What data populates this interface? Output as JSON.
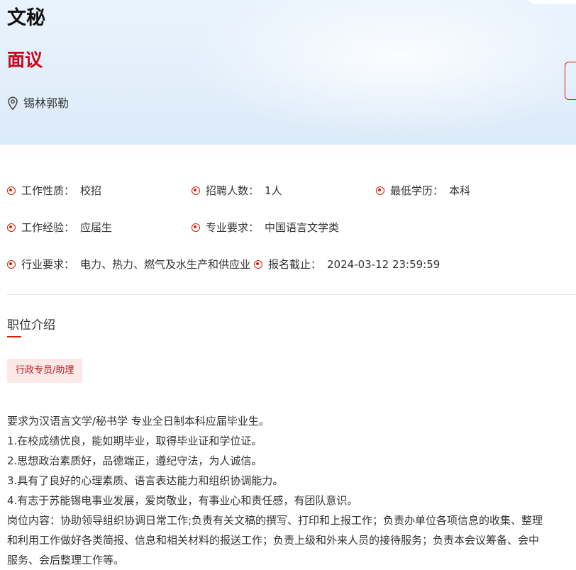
{
  "header": {
    "title": "文秘",
    "salary": "面议",
    "location": "锡林郭勒"
  },
  "info": {
    "row1": [
      {
        "label": "工作性质：",
        "value": "校招"
      },
      {
        "label": "招聘人数：",
        "value": "1人"
      },
      {
        "label": "最低学历：",
        "value": "本科"
      }
    ],
    "row2": [
      {
        "label": "工作经验：",
        "value": "应届生"
      },
      {
        "label": "专业要求：",
        "value": "中国语言文学类"
      }
    ],
    "row3": [
      {
        "label": "行业要求：",
        "value": "电力、热力、燃气及水生产和供应业"
      },
      {
        "label": "报名截止：",
        "value": "2024-03-12 23:59:59"
      }
    ]
  },
  "section": {
    "title": "职位介绍",
    "tag": "行政专员/助理",
    "description": [
      "要求为汉语言文学/秘书学 专业全日制本科应届毕业生。",
      "1.在校成绩优良，能如期毕业，取得毕业证和学位证。",
      "2.思想政治素质好，品德端正，遵纪守法，为人诚信。",
      "3.具有了良好的心理素质、语言表达能力和组织协调能力。",
      "4.有志于苏能锡电事业发展，爱岗敬业，有事业心和责任感，有团队意识。",
      "岗位内容：协助领导组织协调日常工作;负责有关文稿的撰写、打印和上报工作；负责办单位各项信息的收集、整理",
      "和利用工作做好各类简报、信息和相关材料的报送工作；负责上级和外来人员的接待服务；负责本会议筹备、会中",
      "服务、会后整理工作等。"
    ]
  },
  "colors": {
    "accent": "#d81e06",
    "salary": "#d0021b",
    "tag_bg": "#fde8e8"
  },
  "icons": {
    "location": "location-pin-icon",
    "bullet": "radio-dot-icon"
  }
}
